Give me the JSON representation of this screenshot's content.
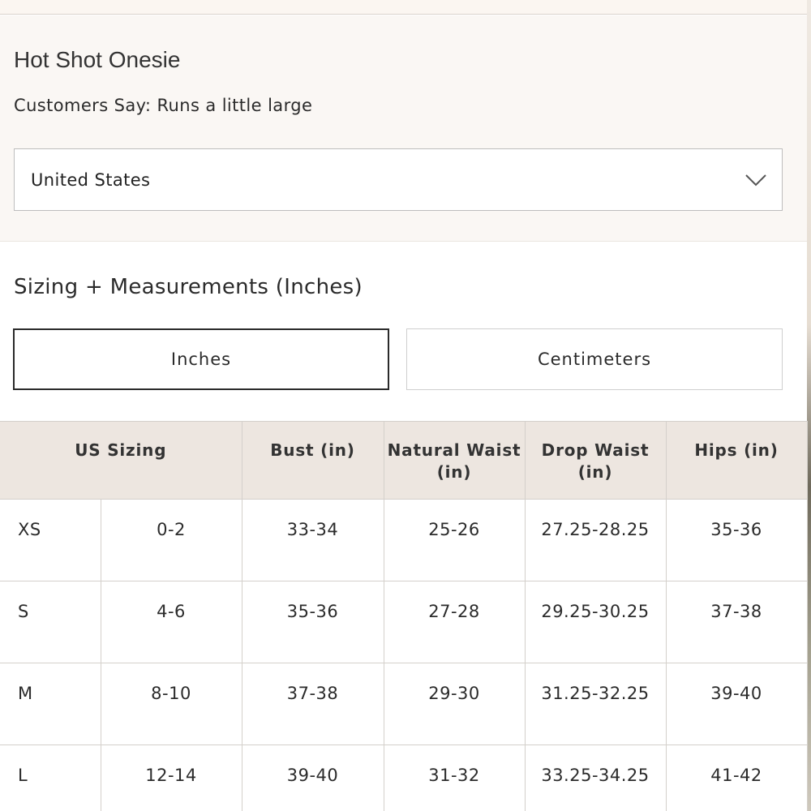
{
  "product": {
    "title": "Hot Shot Onesie",
    "fit_note": "Customers Say: Runs a little large"
  },
  "country_select": {
    "value": "United States",
    "icon": "chevron-down-icon"
  },
  "sizing": {
    "title": "Sizing + Measurements (Inches)",
    "unit_buttons": {
      "inches": "Inches",
      "centimeters": "Centimeters",
      "selected": "Inches"
    },
    "table": {
      "headers": {
        "us_sizing": "US Sizing",
        "bust": "Bust (in)",
        "natural_waist": "Natural Waist (in)",
        "drop_waist": "Drop Waist (in)",
        "hips": "Hips (in)"
      },
      "rows": [
        {
          "size": "XS",
          "us": "0-2",
          "bust": "33-34",
          "natural_waist": "25-26",
          "drop_waist": "27.25-28.25",
          "hips": "35-36"
        },
        {
          "size": "S",
          "us": "4-6",
          "bust": "35-36",
          "natural_waist": "27-28",
          "drop_waist": "29.25-30.25",
          "hips": "37-38"
        },
        {
          "size": "M",
          "us": "8-10",
          "bust": "37-38",
          "natural_waist": "29-30",
          "drop_waist": "31.25-32.25",
          "hips": "39-40"
        },
        {
          "size": "L",
          "us": "12-14",
          "bust": "39-40",
          "natural_waist": "31-32",
          "drop_waist": "33.25-34.25",
          "hips": "41-42"
        }
      ]
    }
  }
}
